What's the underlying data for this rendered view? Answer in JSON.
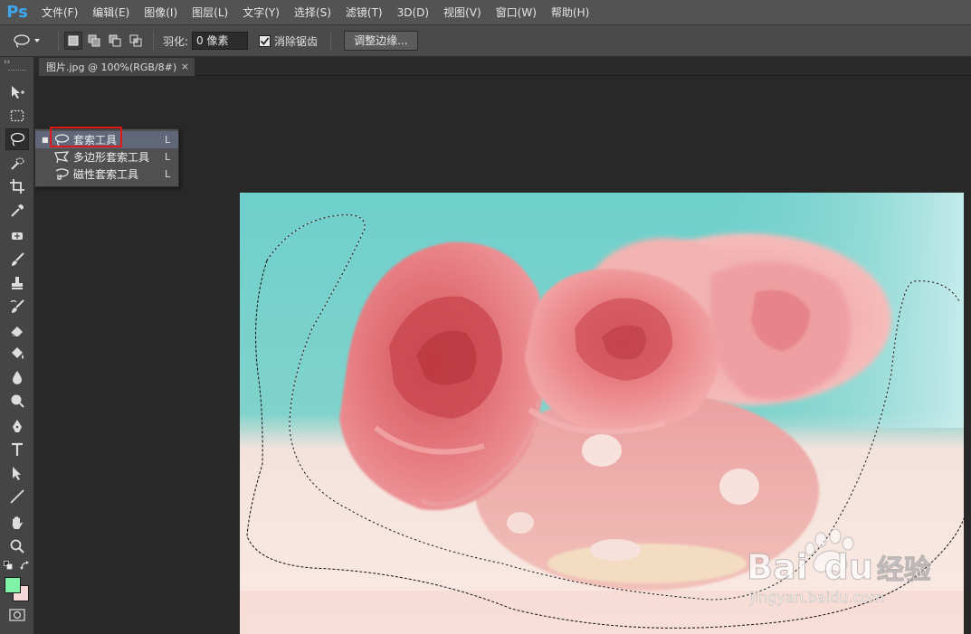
{
  "app": {
    "logo": "Ps"
  },
  "menu": [
    "文件(F)",
    "编辑(E)",
    "图像(I)",
    "图层(L)",
    "文字(Y)",
    "选择(S)",
    "滤镜(T)",
    "3D(D)",
    "视图(V)",
    "窗口(W)",
    "帮助(H)"
  ],
  "options": {
    "feather_label": "羽化:",
    "feather_value": "0 像素",
    "antialias_label": "消除锯齿",
    "antialias_checked": true,
    "refine_edge_label": "调整边缘..."
  },
  "toolbar": {
    "tools": [
      "move-icon",
      "marquee-icon",
      "lasso-icon",
      "quick-selection-icon",
      "crop-icon",
      "eyedropper-icon",
      "healing-brush-icon",
      "brush-icon",
      "clone-stamp-icon",
      "history-brush-icon",
      "eraser-icon",
      "paint-bucket-icon",
      "blur-icon",
      "dodge-icon",
      "pen-icon",
      "type-icon",
      "path-selection-icon",
      "line-icon",
      "hand-icon",
      "zoom-icon"
    ],
    "selected_tool": "lasso-icon",
    "foreground_color": "#7ff4a8",
    "background_color": "#f7d8d9"
  },
  "document_tab": {
    "title": "图片.jpg @ 100%(RGB/8#)",
    "close": "×"
  },
  "flyout": {
    "items": [
      {
        "label": "套索工具",
        "shortcut": "L",
        "active": true
      },
      {
        "label": "多边形套索工具",
        "shortcut": "L",
        "active": false
      },
      {
        "label": "磁性套索工具",
        "shortcut": "L",
        "active": false
      }
    ]
  },
  "colors": {
    "highlight_box": "#e11616",
    "menu_bg": "#535353",
    "canvas_bg": "#282828"
  },
  "watermark": {
    "brand": "Bai",
    "du": "du",
    "cn": "经验",
    "url": "jingyan.baidu.com"
  }
}
